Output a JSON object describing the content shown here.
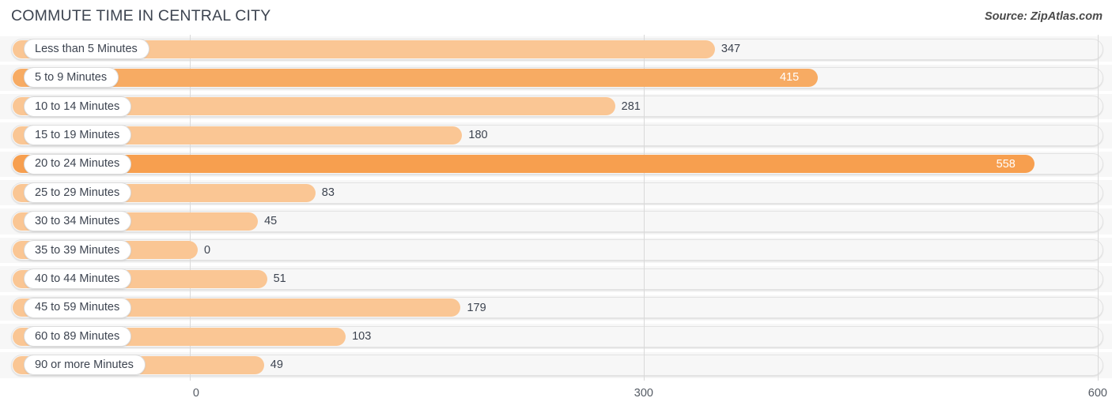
{
  "header": {
    "title": "COMMUTE TIME IN CENTRAL CITY",
    "source": "Source: ZipAtlas.com"
  },
  "colors": {
    "bar_light": "#fac694",
    "bar_mid": "#f7ab63",
    "bar_high": "#f79f4f",
    "track": "#f7f7f7",
    "gridline": "#d9d9d9",
    "text": "#3d4450"
  },
  "axis": {
    "ticks": [
      "0",
      "300",
      "600"
    ],
    "min": 0,
    "max": 600
  },
  "chart_data": {
    "type": "bar",
    "orientation": "horizontal",
    "title": "COMMUTE TIME IN CENTRAL CITY",
    "subtitle": "Source: ZipAtlas.com",
    "xlabel": "",
    "ylabel": "",
    "xlim": [
      0,
      600
    ],
    "xticks": [
      0,
      300,
      600
    ],
    "grid": true,
    "legend": false,
    "categories": [
      "Less than 5 Minutes",
      "5 to 9 Minutes",
      "10 to 14 Minutes",
      "15 to 19 Minutes",
      "20 to 24 Minutes",
      "25 to 29 Minutes",
      "30 to 34 Minutes",
      "35 to 39 Minutes",
      "40 to 44 Minutes",
      "45 to 59 Minutes",
      "60 to 89 Minutes",
      "90 or more Minutes"
    ],
    "values": [
      347,
      415,
      281,
      180,
      558,
      83,
      45,
      0,
      51,
      179,
      103,
      49
    ]
  },
  "rows": [
    {
      "label": "Less than 5 Minutes",
      "value": 347,
      "value_text": "347",
      "inside": false,
      "shade": "light"
    },
    {
      "label": "5 to 9 Minutes",
      "value": 415,
      "value_text": "415",
      "inside": true,
      "shade": "mid"
    },
    {
      "label": "10 to 14 Minutes",
      "value": 281,
      "value_text": "281",
      "inside": false,
      "shade": "light"
    },
    {
      "label": "15 to 19 Minutes",
      "value": 180,
      "value_text": "180",
      "inside": false,
      "shade": "light"
    },
    {
      "label": "20 to 24 Minutes",
      "value": 558,
      "value_text": "558",
      "inside": true,
      "shade": "high"
    },
    {
      "label": "25 to 29 Minutes",
      "value": 83,
      "value_text": "83",
      "inside": false,
      "shade": "light"
    },
    {
      "label": "30 to 34 Minutes",
      "value": 45,
      "value_text": "45",
      "inside": false,
      "shade": "light"
    },
    {
      "label": "35 to 39 Minutes",
      "value": 0,
      "value_text": "0",
      "inside": false,
      "shade": "light"
    },
    {
      "label": "40 to 44 Minutes",
      "value": 51,
      "value_text": "51",
      "inside": false,
      "shade": "light"
    },
    {
      "label": "45 to 59 Minutes",
      "value": 179,
      "value_text": "179",
      "inside": false,
      "shade": "light"
    },
    {
      "label": "60 to 89 Minutes",
      "value": 103,
      "value_text": "103",
      "inside": false,
      "shade": "light"
    },
    {
      "label": "90 or more Minutes",
      "value": 49,
      "value_text": "49",
      "inside": false,
      "shade": "light"
    }
  ]
}
